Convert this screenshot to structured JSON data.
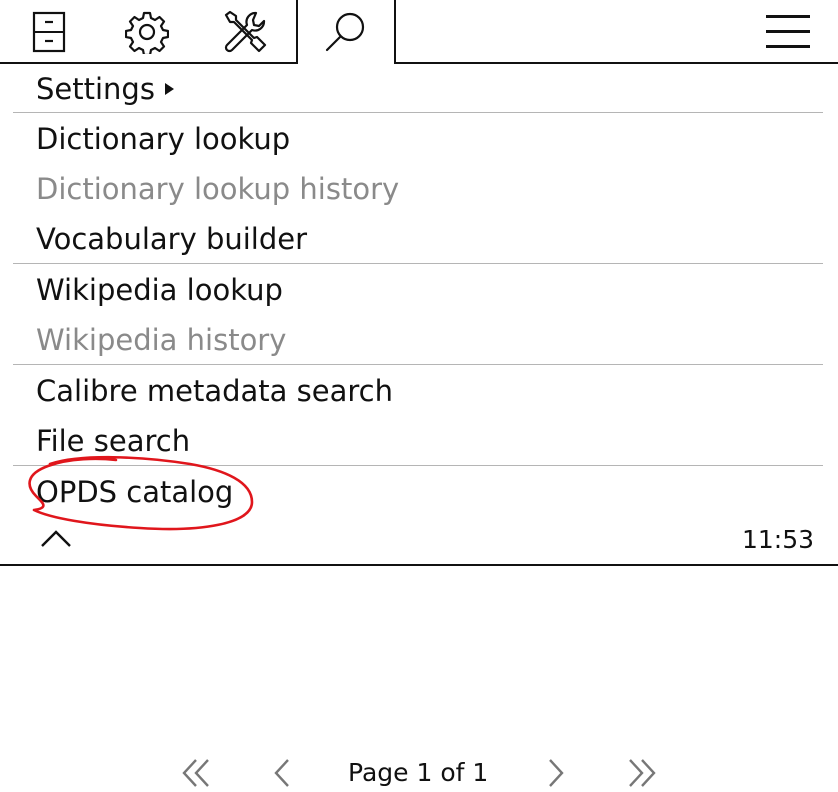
{
  "tabbar": {
    "tabs": [
      {
        "icon": "file-cabinet-icon"
      },
      {
        "icon": "gear-icon"
      },
      {
        "icon": "tools-icon"
      },
      {
        "icon": "search-icon",
        "active": true
      }
    ],
    "menu_icon": "hamburger-icon"
  },
  "menu": {
    "items": [
      {
        "label": "Settings",
        "submenu": true,
        "enabled": true
      },
      {
        "label": "Dictionary lookup",
        "enabled": true
      },
      {
        "label": "Dictionary lookup history",
        "enabled": false
      },
      {
        "label": "Vocabulary builder",
        "enabled": true
      },
      {
        "label": "Wikipedia lookup",
        "enabled": true
      },
      {
        "label": "Wikipedia history",
        "enabled": false
      },
      {
        "label": "Calibre metadata search",
        "enabled": true
      },
      {
        "label": "File search",
        "enabled": true
      },
      {
        "label": "OPDS catalog",
        "enabled": true,
        "highlighted": true
      }
    ],
    "highlight_color": "#e0161c"
  },
  "status": {
    "time": "11:53"
  },
  "pager": {
    "label": "Page 1 of 1",
    "current_page": 1,
    "total_pages": 1
  }
}
